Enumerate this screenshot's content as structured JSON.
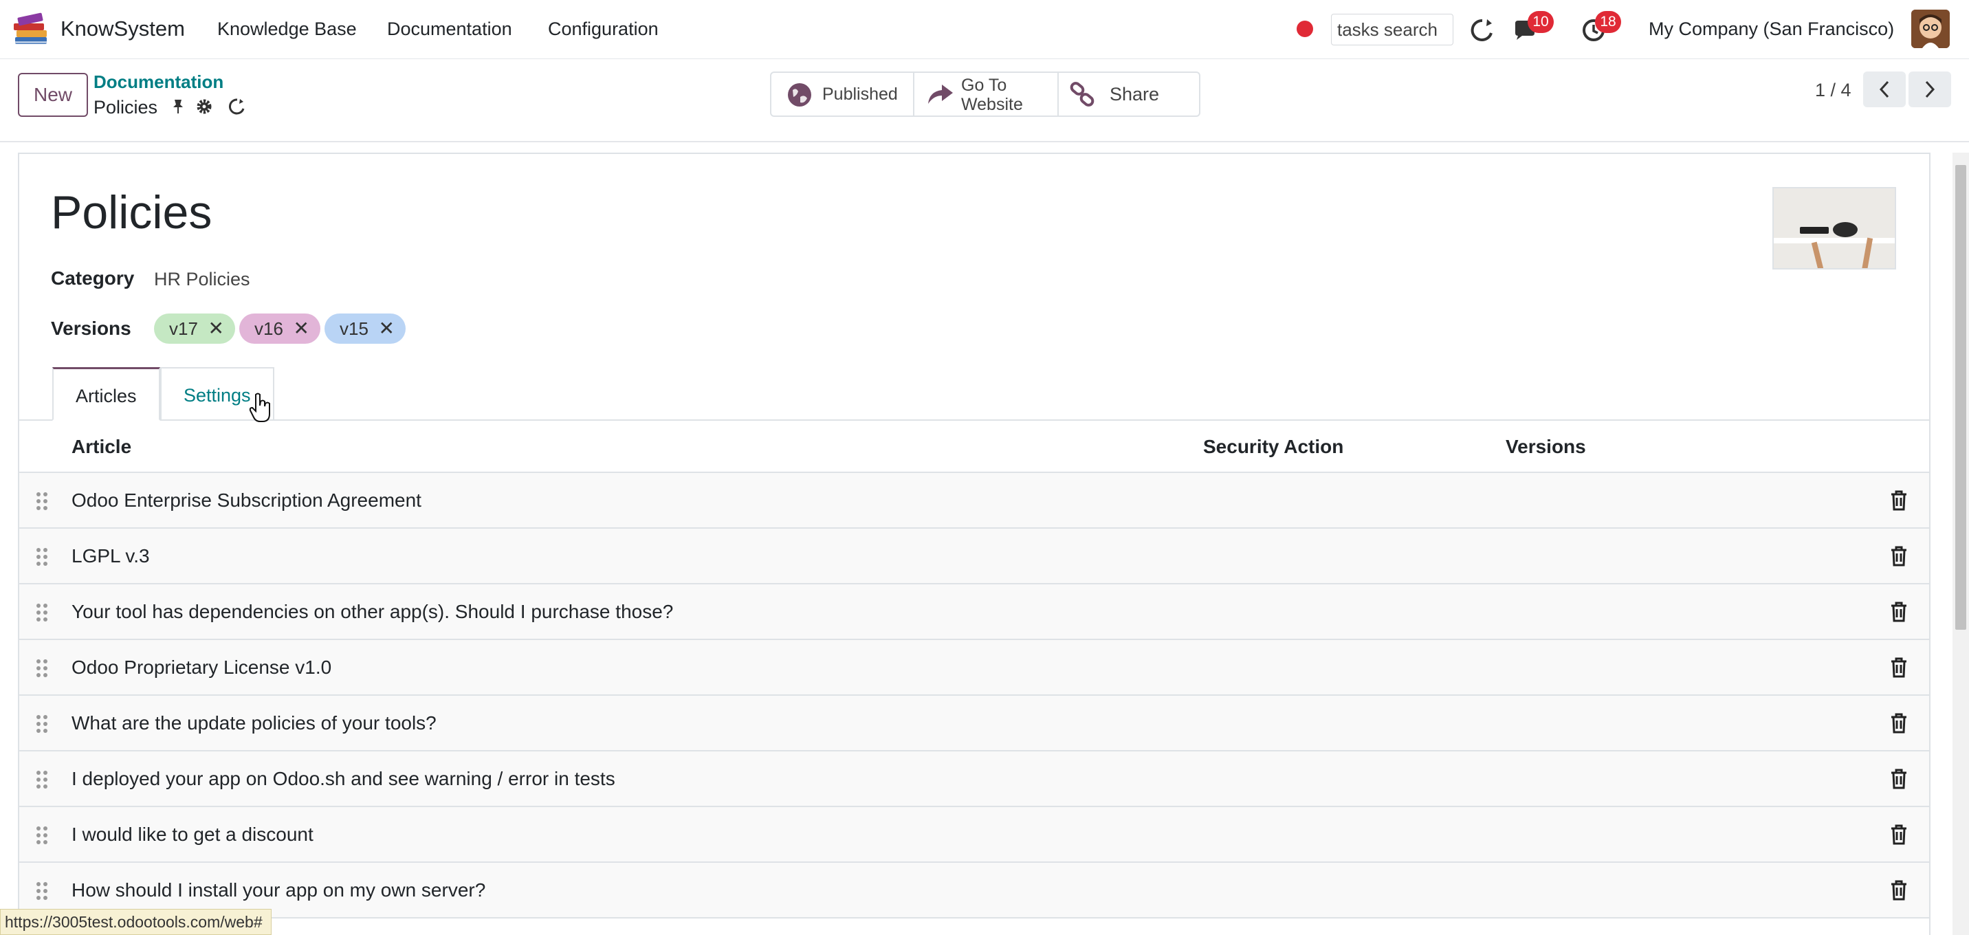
{
  "navbar": {
    "app_name": "KnowSystem",
    "menu": [
      "Knowledge Base",
      "Documentation",
      "Configuration"
    ],
    "search_value": "tasks search",
    "messages_count": "10",
    "activities_count": "18",
    "company": "My Company (San Francisco)"
  },
  "control_panel": {
    "new_label": "New",
    "breadcrumb_parent": "Documentation",
    "breadcrumb_current": "Policies",
    "smart_buttons": {
      "published": "Published",
      "website_line1": "Go To",
      "website_line2": "Website",
      "share": "Share"
    },
    "pager": "1 / 4"
  },
  "form": {
    "title": "Policies",
    "category_label": "Category",
    "category_value": "HR Policies",
    "versions_label": "Versions",
    "tags": [
      {
        "label": "v17",
        "color": "#c5e8c3"
      },
      {
        "label": "v16",
        "color": "#e2b5d8"
      },
      {
        "label": "v15",
        "color": "#b9d4f5"
      }
    ]
  },
  "tabs": [
    "Articles",
    "Settings"
  ],
  "table": {
    "columns": [
      "Article",
      "Security Action",
      "Versions"
    ],
    "rows": [
      "Odoo Enterprise Subscription Agreement",
      "LGPL v.3",
      "Your tool has dependencies on other app(s). Should I purchase those?",
      "Odoo Proprietary License v1.0",
      "What are the update policies of your tools?",
      "I deployed your app on Odoo.sh and see warning / error in tests",
      "I would like to get a discount",
      "How should I install your app on my own server?"
    ]
  },
  "status_url": "https://3005test.odootools.com/web#",
  "colors": {
    "brand": "#714b67",
    "link": "#017e84",
    "badge": "#e02a36"
  }
}
